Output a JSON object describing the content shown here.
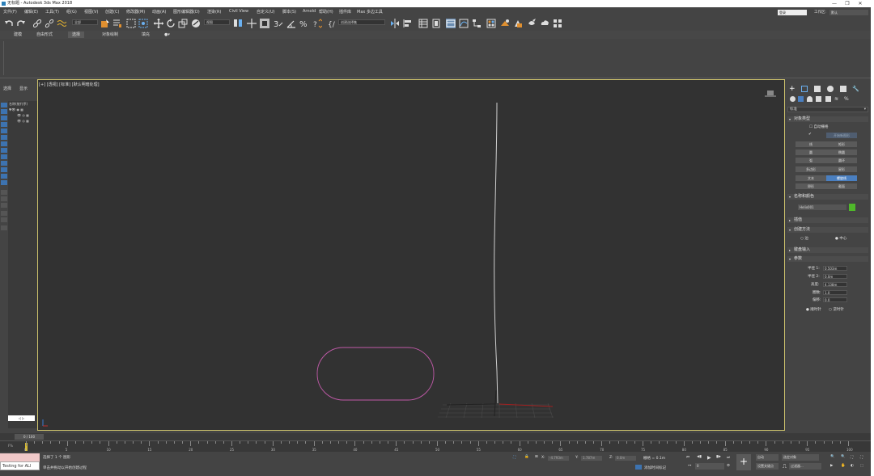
{
  "window": {
    "title": "无标题 - Autodesk 3ds Max 2018"
  },
  "menu": {
    "items": [
      "文件(F)",
      "编辑(E)",
      "工具(T)",
      "组(G)",
      "视图(V)",
      "创建(C)",
      "修改器(M)",
      "动画(A)",
      "图形编辑器(D)",
      "渲染(R)",
      "Civil View",
      "自定义(U)",
      "脚本(S)",
      "Arnold",
      "帮助(H)",
      "插件库",
      "Max 多边工具"
    ],
    "workspace_label": "工作区:",
    "workspace_value": "默认",
    "login": "登录"
  },
  "toolbar": {
    "filter_dropdown": "全部",
    "view_dropdown": "视图",
    "selection_set": "创建选择集"
  },
  "ribbon": {
    "tabs": [
      "建模",
      "自由形式",
      "选择",
      "对象绘制",
      "填充"
    ],
    "active_tab": "选择"
  },
  "scene_explorer": {
    "tabs": [
      "选择",
      "显示"
    ],
    "header": "名称(按升序)",
    "bottom_field": "◁ ▷"
  },
  "viewport": {
    "label": "[+] [透视] [标准] [默认明暗处理]"
  },
  "command_panel": {
    "dropdown": "标准",
    "rollouts": {
      "object_type": "对象类型",
      "name_color": "名称和颜色",
      "interpolation": "插值",
      "creation_method": "创建方法",
      "keyboard_entry": "键盘输入",
      "parameters": "参数"
    },
    "autogrid": "自动栅格",
    "start_new_shape": "开始新图形",
    "object_buttons": [
      [
        "线",
        "矩形"
      ],
      [
        "圆",
        "椭圆"
      ],
      [
        "弧",
        "圆环"
      ],
      [
        "多边形",
        "星形"
      ],
      [
        "文本",
        "螺旋线"
      ],
      [
        "卵形",
        "截面"
      ]
    ],
    "active_button": "螺旋线",
    "name_value": "Helix001",
    "name_color": "#4fb82a",
    "creation": {
      "edge": "边",
      "center": "中心",
      "selected": "中心"
    },
    "params": [
      {
        "label": "半径 1:",
        "value": "0.503m"
      },
      {
        "label": "半径 2:",
        "value": "0.0m"
      },
      {
        "label": "高度:",
        "value": "4.138m"
      },
      {
        "label": "圈数:",
        "value": "1.0"
      },
      {
        "label": "偏移:",
        "value": "0.0"
      }
    ],
    "direction": {
      "cw": "顺时针",
      "ccw": "逆时针"
    }
  },
  "timeline": {
    "frame_counter": "0 / 100",
    "ticks": [
      "0",
      "5",
      "10",
      "15",
      "20",
      "25",
      "30",
      "35",
      "40",
      "45",
      "50",
      "55",
      "60",
      "65",
      "70",
      "75",
      "80",
      "85",
      "90",
      "95",
      "100"
    ]
  },
  "statusbar": {
    "maxscript": "Testing for ALI",
    "selected": "选择了 1 个 图形",
    "prompt": "单击并拖动以开始创建过程",
    "x_label": "X:",
    "x_value": "-4.793m",
    "y_label": "Y:",
    "y_value": "1.787m",
    "z_label": "Z:",
    "z_value": "0.0m",
    "grid": "栅格 = 0.1m",
    "add_time_tag": "添加时间标记",
    "auto_key": "自动",
    "set_key": "设置关键点",
    "selected_object": "选定对象",
    "key_filters": "过滤器...",
    "frame_field": "0"
  }
}
